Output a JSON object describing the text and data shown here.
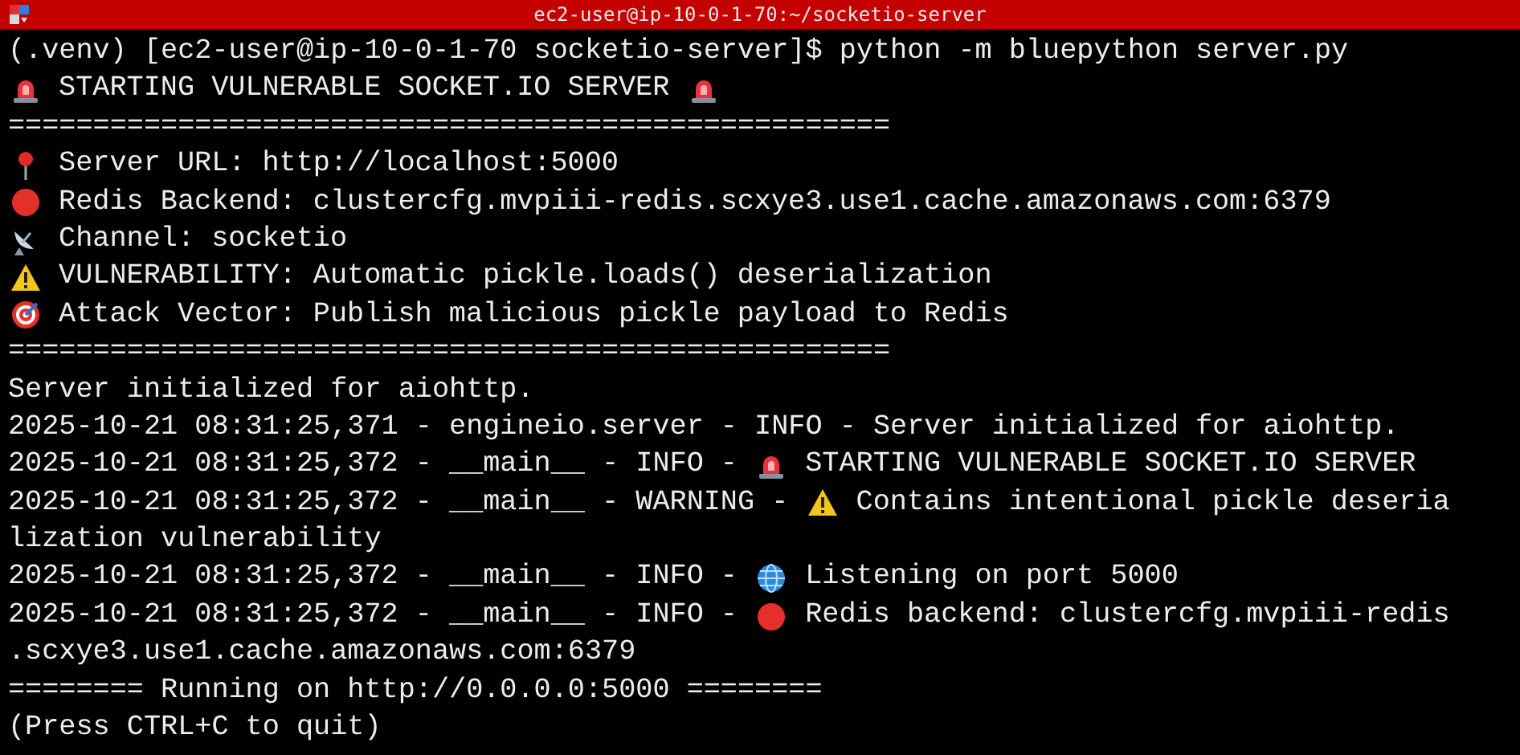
{
  "window": {
    "title": "ec2-user@ip-10-0-1-70:~/socketio-server"
  },
  "lines": [
    [
      {
        "kind": "text",
        "text": "(.venv) [ec2-user@ip-10-0-1-70 socketio-server]$ python -m bluepython server.py"
      }
    ],
    [
      {
        "kind": "siren"
      },
      {
        "kind": "text",
        "text": " STARTING VULNERABLE SOCKET.IO SERVER "
      },
      {
        "kind": "siren"
      }
    ],
    [
      {
        "kind": "text",
        "text": "===================================================="
      }
    ],
    [
      {
        "kind": "pin"
      },
      {
        "kind": "text",
        "text": " Server URL: http://localhost:5000"
      }
    ],
    [
      {
        "kind": "dot"
      },
      {
        "kind": "text",
        "text": " Redis Backend: clustercfg.mvpiii-redis.scxye3.use1.cache.amazonaws.com:6379"
      }
    ],
    [
      {
        "kind": "dish"
      },
      {
        "kind": "text",
        "text": " Channel: socketio"
      }
    ],
    [
      {
        "kind": "warning"
      },
      {
        "kind": "text",
        "text": " VULNERABILITY: Automatic pickle.loads() deserialization"
      }
    ],
    [
      {
        "kind": "target"
      },
      {
        "kind": "text",
        "text": " Attack Vector: Publish malicious pickle payload to Redis"
      }
    ],
    [
      {
        "kind": "text",
        "text": "===================================================="
      }
    ],
    [
      {
        "kind": "text",
        "text": "Server initialized for aiohttp."
      }
    ],
    [
      {
        "kind": "text",
        "text": "2025-10-21 08:31:25,371 - engineio.server - INFO - Server initialized for aiohttp."
      }
    ],
    [
      {
        "kind": "text",
        "text": "2025-10-21 08:31:25,372 - __main__ - INFO - "
      },
      {
        "kind": "siren"
      },
      {
        "kind": "text",
        "text": " STARTING VULNERABLE SOCKET.IO SERVER"
      }
    ],
    [
      {
        "kind": "text",
        "text": "2025-10-21 08:31:25,372 - __main__ - WARNING - "
      },
      {
        "kind": "warning"
      },
      {
        "kind": "text",
        "text": " Contains intentional pickle deseria"
      }
    ],
    [
      {
        "kind": "text",
        "text": "lization vulnerability"
      }
    ],
    [
      {
        "kind": "text",
        "text": "2025-10-21 08:31:25,372 - __main__ - INFO - "
      },
      {
        "kind": "globe"
      },
      {
        "kind": "text",
        "text": " Listening on port 5000"
      }
    ],
    [
      {
        "kind": "text",
        "text": "2025-10-21 08:31:25,372 - __main__ - INFO - "
      },
      {
        "kind": "dot"
      },
      {
        "kind": "text",
        "text": " Redis backend: clustercfg.mvpiii-redis"
      }
    ],
    [
      {
        "kind": "text",
        "text": ".scxye3.use1.cache.amazonaws.com:6379"
      }
    ],
    [
      {
        "kind": "text",
        "text": "======== Running on http://0.0.0.0:5000 ========"
      }
    ],
    [
      {
        "kind": "text",
        "text": "(Press CTRL+C to quit)"
      }
    ]
  ]
}
